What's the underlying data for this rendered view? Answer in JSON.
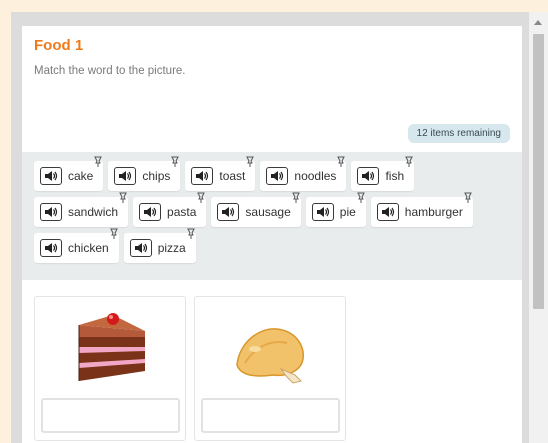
{
  "activity": {
    "title": "Food 1",
    "instructions": "Match the word to the picture.",
    "remaining": "12 items remaining"
  },
  "word_bank": [
    [
      "cake",
      "chips",
      "toast",
      "noodles",
      "fish"
    ],
    [
      "sandwich",
      "pasta",
      "sausage",
      "pie",
      "hamburger"
    ],
    [
      "chicken",
      "pizza"
    ]
  ],
  "pictures": [
    {
      "name": "cake-picture",
      "answer": ""
    },
    {
      "name": "chicken-picture",
      "answer": ""
    }
  ],
  "icons": {
    "speaker": "speaker-icon",
    "hint": "hint-pin-icon"
  },
  "colors": {
    "accent": "#f07a1a",
    "badge": "#d6e7ee",
    "bank_bg": "#e8eced",
    "page_bg": "#fdf1de"
  }
}
